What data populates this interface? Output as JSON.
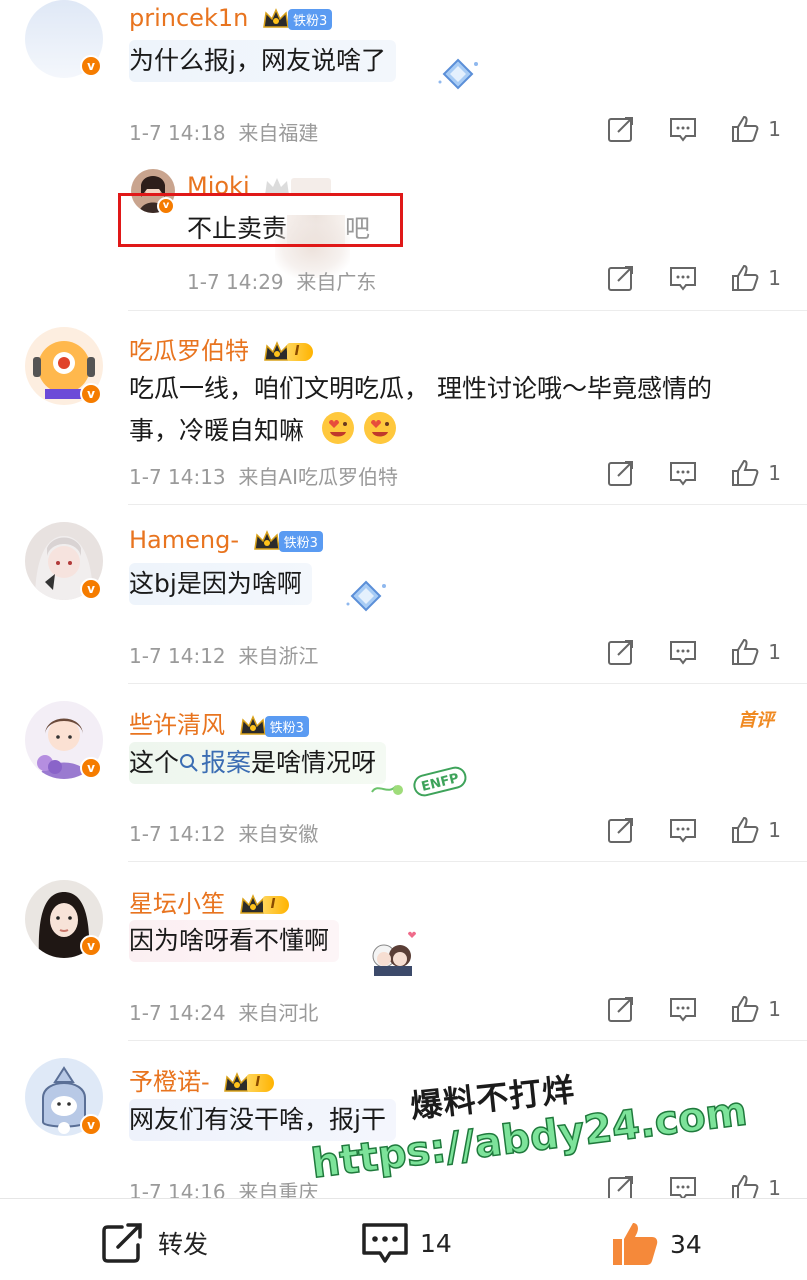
{
  "comments": [
    {
      "name": "princek1n",
      "badge": "铁粉3",
      "text": "为什么报j，网友说啥了",
      "time": "1-7 14:18",
      "location": "来自福建",
      "likes": "1"
    },
    {
      "name": "吃瓜罗伯特",
      "badge": "I",
      "text_line1": "吃瓜一线，咱们文明吃瓜， 理性讨论哦～毕竟感情的",
      "text_line2": "事，冷暖自知嘛",
      "time": "1-7 14:13",
      "location": "来自AI吃瓜罗伯特",
      "likes": "1"
    },
    {
      "name": "Hameng-",
      "badge": "铁粉3",
      "text": "这bj是因为啥啊",
      "time": "1-7 14:12",
      "location": "来自浙江",
      "likes": "1"
    },
    {
      "name": "些许清风",
      "badge": "铁粉3",
      "text_pre": "这个",
      "hashtag": "报案",
      "text_post": "是啥情况呀",
      "first_label": "首评",
      "time": "1-7 14:12",
      "location": "来自安徽",
      "likes": "1"
    },
    {
      "name": "星坛小笙",
      "badge": "I",
      "text": "因为啥呀看不懂啊",
      "time": "1-7 14:24",
      "location": "来自河北",
      "likes": "1"
    },
    {
      "name": "予橙诺-",
      "badge": "I",
      "text": "网友们有没干啥，报j干",
      "time": "1-7 14:16",
      "location": "来自重庆",
      "likes": "1"
    }
  ],
  "reply": {
    "name": "Mioki",
    "text": "不止卖责",
    "text_tail": "吧",
    "time": "1-7 14:29",
    "location": "来自广东",
    "likes": "1"
  },
  "watermark": {
    "line1": "爆料不打烊",
    "line2": "https://abdy24.com"
  },
  "bottom": {
    "repost": "转发",
    "comments": "14",
    "likes": "34"
  },
  "colors": {
    "name": "#e8741f",
    "link": "#3b6db3",
    "meta": "#9a9a9a",
    "like_active": "#f5893a"
  }
}
